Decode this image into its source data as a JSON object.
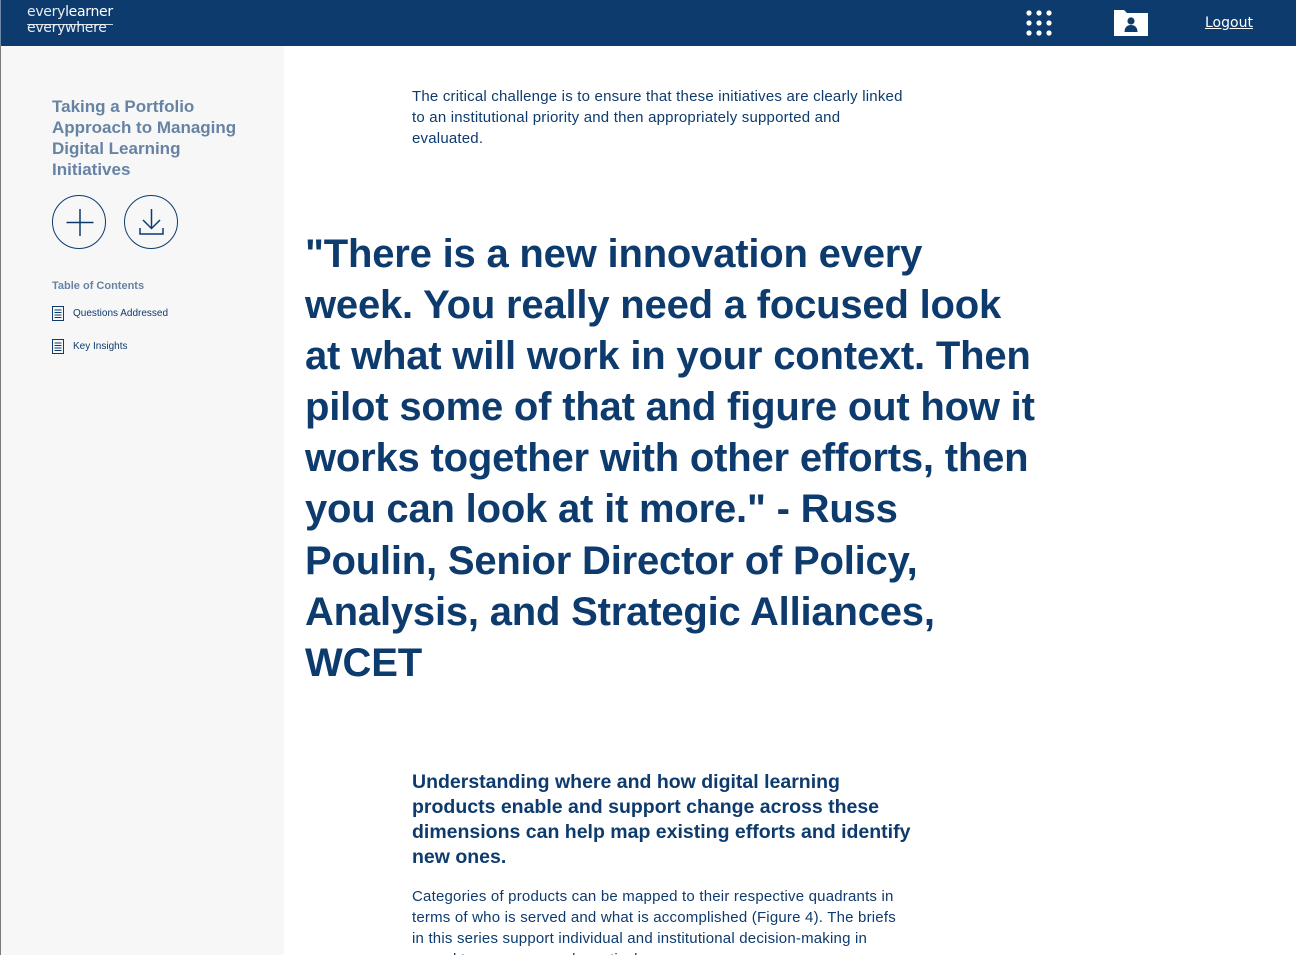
{
  "header": {
    "logo_top_light": "every",
    "logo_top_bold": "learner",
    "logo_bottom": "everywhere",
    "apps_icon": "grid-dots-icon",
    "profile_icon": "profile-folder-icon",
    "logout_label": "Logout"
  },
  "sidebar": {
    "title": "Taking a Portfolio Approach to Managing Digital Learning Initiatives",
    "add_icon": "plus-circle-icon",
    "download_icon": "download-circle-icon",
    "toc_heading": "Table of Contents",
    "toc_items": [
      {
        "label": "Questions Addressed",
        "icon": "document-icon"
      },
      {
        "label": "Key Insights",
        "icon": "document-icon"
      }
    ]
  },
  "main": {
    "intro": "The critical challenge is to ensure that these initiatives are clearly linked to an institutional priority and then appropriately supported and evaluated.",
    "quote": "\"There is a new innovation every week. You really need a focused look at what will work in your context. Then pilot some of that and figure out how it works together with other efforts, then you can look at it more.\" - Russ Poulin, Senior Director of Policy, Analysis, and Strategic Alliances, WCET",
    "subheading": "Understanding where and how digital learning products enable and support change across these dimensions can help map existing efforts and identify new ones.",
    "paragraph": "Categories of products can be mapped to their respective quadrants in terms of who is served and what is accomplished (Figure 4). The briefs in this series support individual and institutional decision-making in regard to consumer and practical"
  },
  "colors": {
    "brand_navy": "#0d3b6e",
    "sidebar_title": "#6783a4",
    "sidebar_bg": "#f7f7f7"
  }
}
